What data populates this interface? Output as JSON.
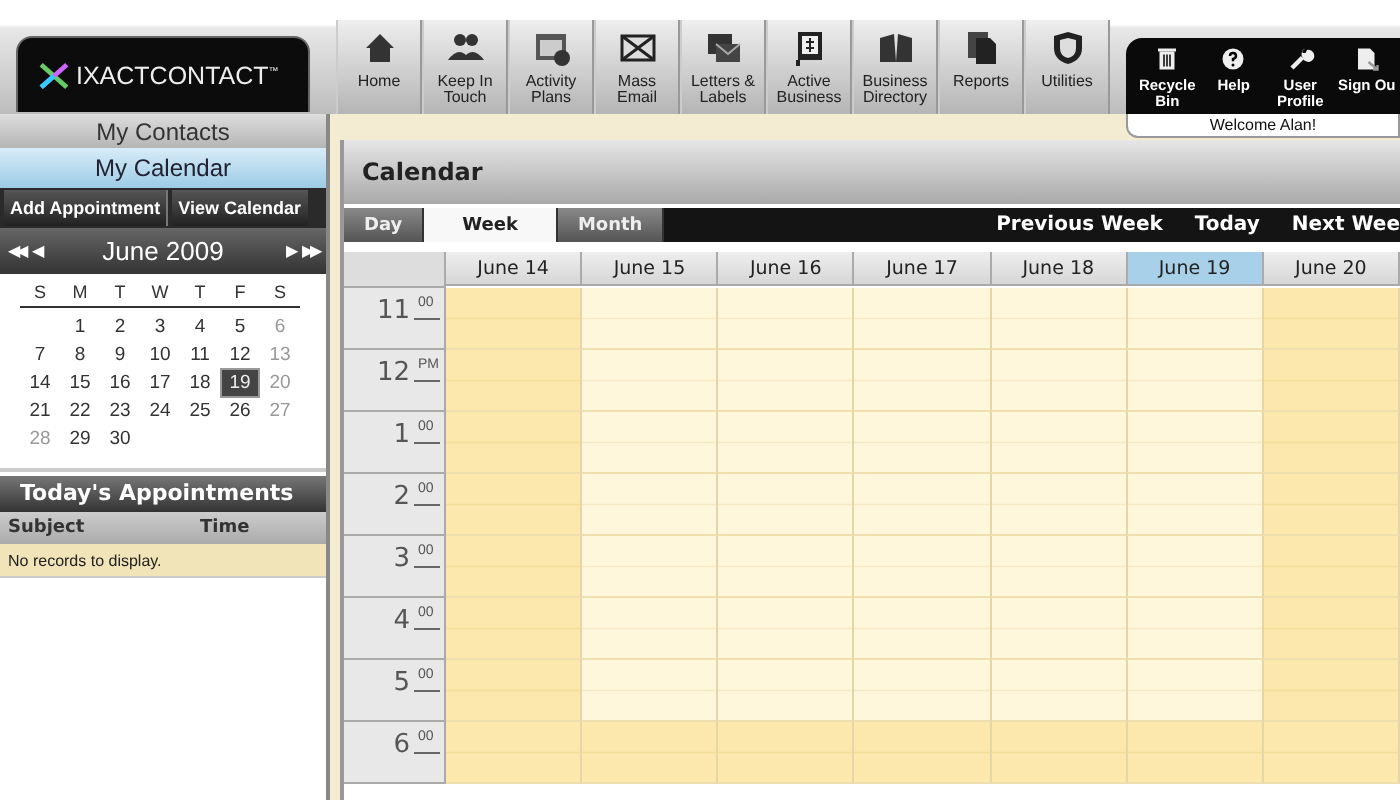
{
  "logo": {
    "text": "IXACTCONTACT",
    "mark": "™"
  },
  "toolbar": [
    {
      "label": "Home"
    },
    {
      "label": "Keep In\nTouch"
    },
    {
      "label": "Activity\nPlans"
    },
    {
      "label": "Mass\nEmail"
    },
    {
      "label": "Letters &\nLabels"
    },
    {
      "label": "Active\nBusiness"
    },
    {
      "label": "Business\nDirectory"
    },
    {
      "label": "Reports"
    },
    {
      "label": "Utilities"
    }
  ],
  "account_menu": [
    {
      "label": "Recycle\nBin"
    },
    {
      "label": "Help"
    },
    {
      "label": "User\nProfile"
    },
    {
      "label": "Sign Ou"
    }
  ],
  "welcome": "Welcome Alan!",
  "sidebar": {
    "sections": [
      {
        "label": "My Contacts",
        "selected": false
      },
      {
        "label": "My Calendar",
        "selected": true
      }
    ],
    "buttons": [
      "Add Appointment",
      "View Calendar"
    ],
    "mini_calendar": {
      "prev_year": "◀◀",
      "prev_month": "◀",
      "title": "June 2009",
      "next_month": "▶",
      "next_year": "▶▶",
      "weekdays": [
        "S",
        "M",
        "T",
        "W",
        "T",
        "F",
        "S"
      ],
      "weeks": [
        [
          {
            "label": "1",
            "muted": false,
            "selected": false
          },
          {
            "label": "2",
            "muted": false,
            "selected": false
          },
          {
            "label": "3",
            "muted": false,
            "selected": false
          },
          {
            "label": "4",
            "muted": false,
            "selected": false
          },
          {
            "label": "5",
            "muted": false,
            "selected": false
          },
          {
            "label": "6",
            "muted": true,
            "selected": false
          }
        ],
        [
          {
            "label": "7",
            "muted": false,
            "selected": false
          },
          {
            "label": "8",
            "muted": false,
            "selected": false
          },
          {
            "label": "9",
            "muted": false,
            "selected": false
          },
          {
            "label": "10",
            "muted": false,
            "selected": false
          },
          {
            "label": "11",
            "muted": false,
            "selected": false
          },
          {
            "label": "12",
            "muted": false,
            "selected": false
          },
          {
            "label": "13",
            "muted": true,
            "selected": false
          }
        ],
        [
          {
            "label": "14",
            "muted": false,
            "selected": false
          },
          {
            "label": "15",
            "muted": false,
            "selected": false
          },
          {
            "label": "16",
            "muted": false,
            "selected": false
          },
          {
            "label": "17",
            "muted": false,
            "selected": false
          },
          {
            "label": "18",
            "muted": false,
            "selected": false
          },
          {
            "label": "19",
            "muted": false,
            "selected": true
          },
          {
            "label": "20",
            "muted": true,
            "selected": false
          }
        ],
        [
          {
            "label": "21",
            "muted": false,
            "selected": false
          },
          {
            "label": "22",
            "muted": false,
            "selected": false
          },
          {
            "label": "23",
            "muted": false,
            "selected": false
          },
          {
            "label": "24",
            "muted": false,
            "selected": false
          },
          {
            "label": "25",
            "muted": false,
            "selected": false
          },
          {
            "label": "26",
            "muted": false,
            "selected": false
          },
          {
            "label": "27",
            "muted": true,
            "selected": false
          }
        ],
        [
          {
            "label": "28",
            "muted": true,
            "selected": false
          },
          {
            "label": "29",
            "muted": false,
            "selected": false
          },
          {
            "label": "30",
            "muted": false,
            "selected": false
          }
        ]
      ]
    },
    "appointments": {
      "title": "Today's Appointments",
      "columns": [
        "Subject",
        "Time"
      ],
      "empty": "No records to display."
    }
  },
  "calendar": {
    "title": "Calendar",
    "views": [
      {
        "label": "Day",
        "selected": false
      },
      {
        "label": "Week",
        "selected": true
      },
      {
        "label": "Month",
        "selected": false
      }
    ],
    "nav": [
      "Previous Week",
      "Today",
      "Next Wee"
    ],
    "days": [
      {
        "label": "June 14",
        "weekend": true,
        "selected": false
      },
      {
        "label": "June 15",
        "weekend": false,
        "selected": false
      },
      {
        "label": "June 16",
        "weekend": false,
        "selected": false
      },
      {
        "label": "June 17",
        "weekend": false,
        "selected": false
      },
      {
        "label": "June 18",
        "weekend": false,
        "selected": false
      },
      {
        "label": "June 19",
        "weekend": false,
        "selected": true
      },
      {
        "label": "June 20",
        "weekend": true,
        "selected": false
      }
    ],
    "hours": [
      {
        "hour": "11",
        "suffix": "00",
        "after_hours": false
      },
      {
        "hour": "12",
        "suffix": "PM",
        "after_hours": false
      },
      {
        "hour": "1",
        "suffix": "00",
        "after_hours": false
      },
      {
        "hour": "2",
        "suffix": "00",
        "after_hours": false
      },
      {
        "hour": "3",
        "suffix": "00",
        "after_hours": false
      },
      {
        "hour": "4",
        "suffix": "00",
        "after_hours": false
      },
      {
        "hour": "5",
        "suffix": "00",
        "after_hours": false
      },
      {
        "hour": "6",
        "suffix": "00",
        "after_hours": true
      }
    ]
  }
}
